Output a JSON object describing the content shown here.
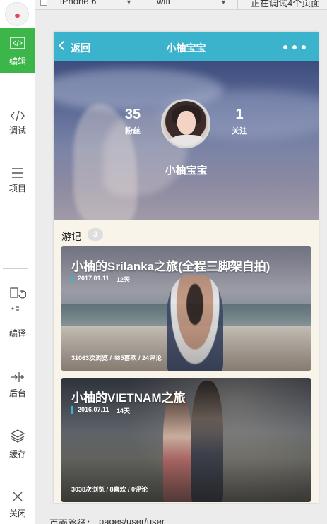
{
  "toolbar": {
    "device": "iPhone 6",
    "network": "wifi",
    "debug_status": "正在调试4个页面"
  },
  "sidebar": {
    "items": [
      {
        "label": "编辑",
        "icon": "code-icon",
        "active": true
      },
      {
        "label": "调试",
        "icon": "debug-icon"
      },
      {
        "label": "项目",
        "icon": "menu-icon"
      },
      {
        "label": "编译",
        "icon": "compile-icon"
      },
      {
        "label": "后台",
        "icon": "background-icon"
      },
      {
        "label": "缓存",
        "icon": "layers-icon"
      },
      {
        "label": "关闭",
        "icon": "close-icon"
      }
    ]
  },
  "navbar": {
    "back_label": "返回",
    "title": "小柚宝宝",
    "color": "#3bb3cc"
  },
  "profile": {
    "fans_count": "35",
    "fans_label": "粉丝",
    "follow_count": "1",
    "follow_label": "关注",
    "name": "小柚宝宝"
  },
  "travels": {
    "section_title": "游记",
    "count": "3",
    "cards": [
      {
        "title": "小柚的Srilanka之旅(全程三脚架自拍)",
        "date": "2017.01.11",
        "days": "12天",
        "stats": "31063次浏览 / 485喜欢 / 24评论"
      },
      {
        "title": "小柚的VIETNAM之旅",
        "date": "2016.07.11",
        "days": "14天",
        "stats": "3038次浏览 / 8喜欢 / 0评论"
      }
    ]
  },
  "footer": {
    "path_label": "页面路径：",
    "path_value": "pages/user/user"
  },
  "colors": {
    "accent_green": "#3cb648",
    "navbar_blue": "#3bb3cc"
  }
}
